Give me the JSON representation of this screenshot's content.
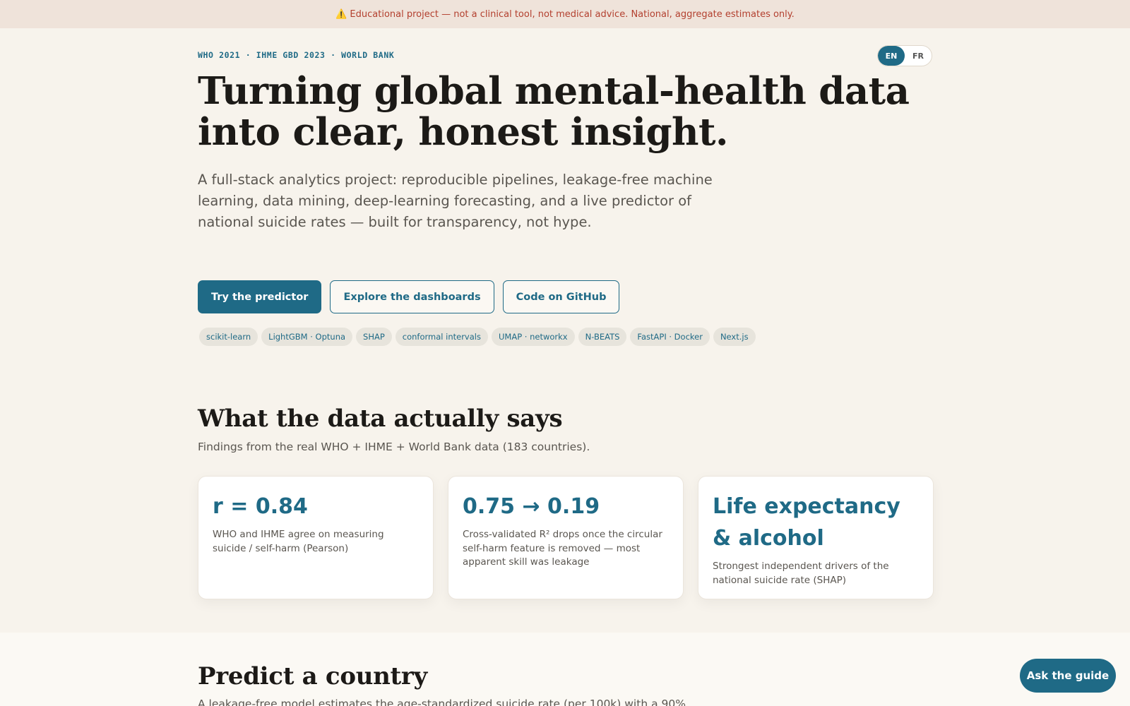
{
  "banner": {
    "icon": "warning-icon",
    "text": "Educational project — not a clinical tool, not medical advice. National, aggregate estimates only."
  },
  "hero": {
    "eyebrow": "WHO 2021 · IHME GBD 2023 · WORLD BANK",
    "lang": {
      "en": "EN",
      "fr": "FR",
      "active": "EN"
    },
    "title": "Turning global mental-health data into clear, honest insight.",
    "lede": "A full-stack analytics project: reproducible pipelines, leakage-free machine learning, data mining, deep-learning forecasting, and a live predictor of national suicide rates — built for transparency, not hype.",
    "ctas": {
      "primary": "Try the predictor",
      "dashboards": "Explore the dashboards",
      "github": "Code on GitHub"
    },
    "chips": [
      "scikit-learn",
      "LightGBM · Optuna",
      "SHAP",
      "conformal intervals",
      "UMAP · networkx",
      "N-BEATS",
      "FastAPI · Docker",
      "Next.js"
    ]
  },
  "findings": {
    "title": "What the data actually says",
    "subtitle": "Findings from the real WHO + IHME + World Bank data (183 countries).",
    "cards": [
      {
        "big": "r = 0.84",
        "desc": "WHO and IHME agree on measuring suicide / self-harm (Pearson)"
      },
      {
        "big": "0.75 → 0.19",
        "desc": "Cross-validated R² drops once the circular self-harm feature is removed — most apparent skill was leakage"
      },
      {
        "big": "Life expectancy & alcohol",
        "desc": "Strongest independent drivers of the national suicide rate (SHAP)"
      }
    ]
  },
  "predict": {
    "title": "Predict a country",
    "lede_partial": "A leakage-free model estimates the age-standardized suicide rate (per 100k) with a 90%"
  },
  "guide_button": "Ask the guide",
  "colors": {
    "accent": "#1f6a86",
    "banner_text": "#b3402f",
    "banner_bg": "#efe3da",
    "page_bg": "#f7f3ec"
  }
}
